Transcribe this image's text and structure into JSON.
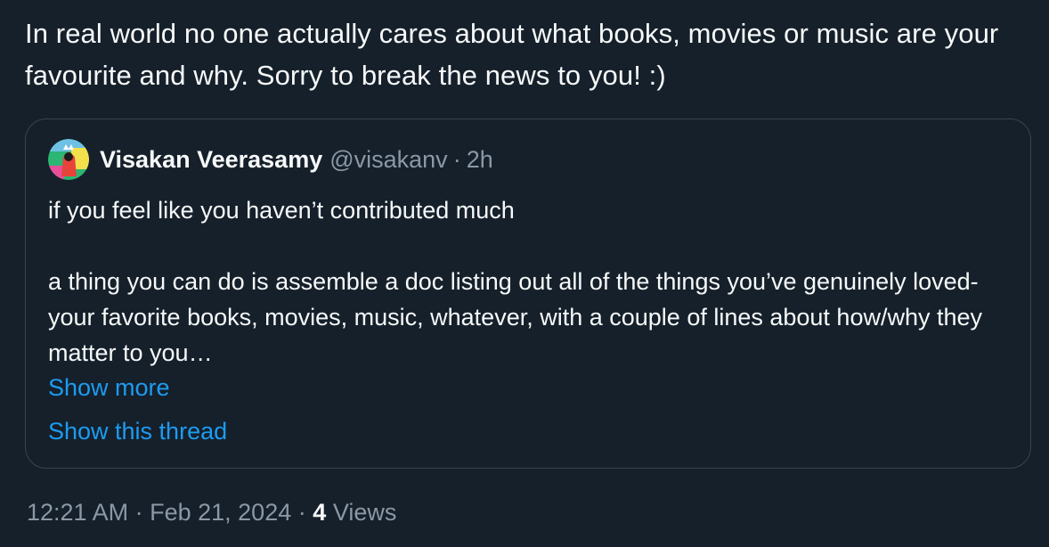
{
  "post": {
    "text": "In real world no one actually cares about what books, movies or music are your favourite and why. Sorry to break the news to you! :)"
  },
  "quoted_post": {
    "author_name": "Visakan Veerasamy",
    "author_handle": "@visakanv",
    "separator": "·",
    "age": "2h",
    "avatar_icon": "avatar-image",
    "paragraphs": [
      "if you feel like you haven’t contributed much",
      "a thing you can do is assemble a doc listing out all of the things you’ve genuinely loved- your favorite books, movies, music, whatever, with a couple of lines about how/why they matter to you…"
    ],
    "show_more_label": "Show more",
    "show_thread_label": "Show this thread"
  },
  "meta": {
    "time": "12:21 AM",
    "separator": "·",
    "date": "Feb 21, 2024",
    "views_count": "4",
    "views_label": "Views"
  },
  "colors": {
    "background": "#15202b",
    "text": "#f7f9f9",
    "muted": "#8b98a5",
    "link": "#1d9bf0",
    "border": "#38444d"
  }
}
